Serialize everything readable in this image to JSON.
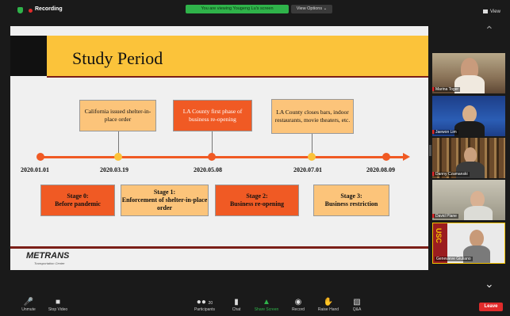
{
  "topbar": {
    "recording_label": "Recording",
    "viewing_banner": "You are viewing Yougeng Lu's screen",
    "view_options": "View Options ⌄",
    "view_button": "View"
  },
  "slide": {
    "title": "Study Period",
    "dates": [
      "2020.01.01",
      "2020.03.19",
      "2020.05.08",
      "2020.07.01",
      "2020.08.09"
    ],
    "events": [
      "California issued shelter-in-place order",
      "LA County first phase of business re-opening",
      "LA County closes bars, indoor restaurants, movie theaters, etc."
    ],
    "stages": [
      {
        "title": "Stage 0:",
        "desc": "Before pandemic"
      },
      {
        "title": "Stage 1:",
        "desc": "Enforcement of shelter-in-place order"
      },
      {
        "title": "Stage 2:",
        "desc": "Business re-opening"
      },
      {
        "title": "Stage 3:",
        "desc": "Business restriction"
      }
    ],
    "logo": "METRANS",
    "logo_sub": "Transportation Center",
    "colors": {
      "gold": "#fbc33a",
      "orange": "#f05a24",
      "peach": "#fcc47a",
      "maroon": "#7b1f18"
    }
  },
  "participants": [
    {
      "name": "Marina Toger"
    },
    {
      "name": "Jaewon Lim"
    },
    {
      "name": "Danny Czamanski"
    },
    {
      "name": "David Plane"
    },
    {
      "name": "Genevieve Giuliano",
      "logo_text": "USC"
    }
  ],
  "toolbar": {
    "unmute": "Unmute",
    "stop_video": "Stop Video",
    "participants": "Participants",
    "participants_count": "20",
    "chat": "Chat",
    "share_screen": "Share Screen",
    "record": "Record",
    "raise_hand": "Raise Hand",
    "qa": "Q&A",
    "leave": "Leave"
  }
}
